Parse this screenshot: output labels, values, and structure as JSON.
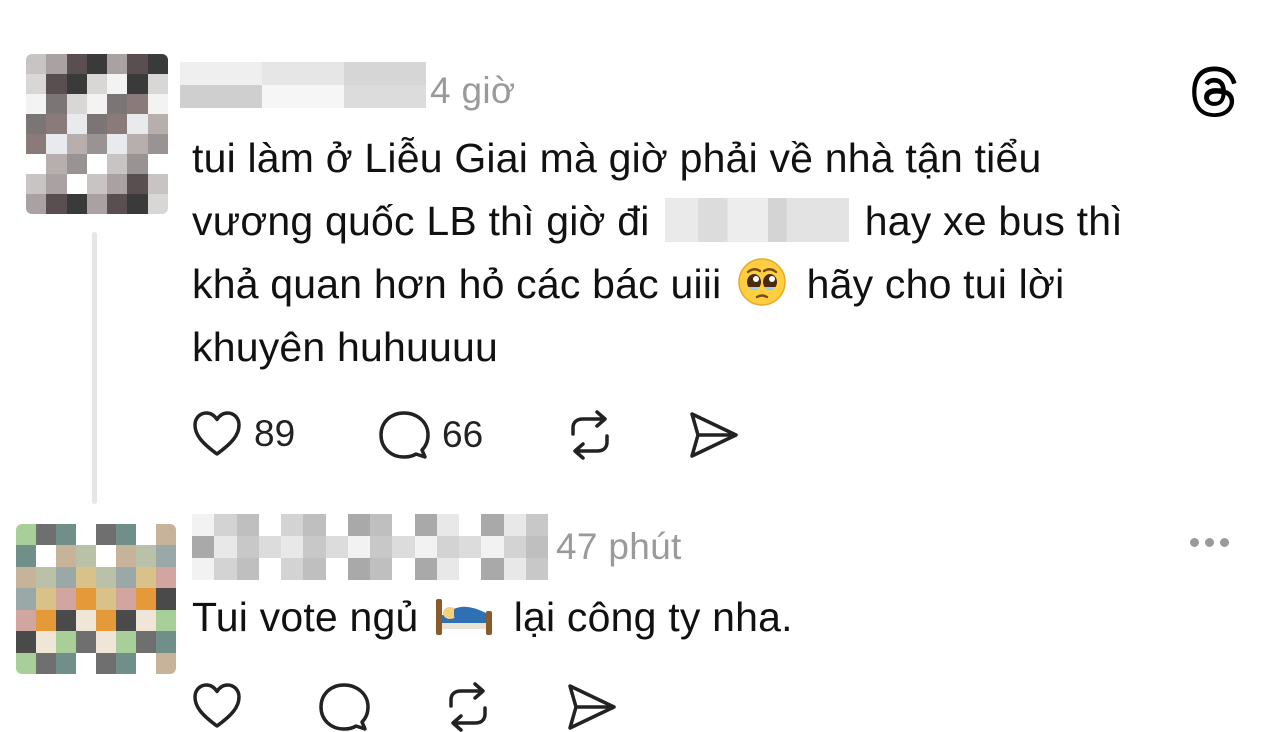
{
  "comments": [
    {
      "time": "4 giờ",
      "text_line1": "tui làm ở Liễu Giai mà giờ phải về nhà tận tiểu",
      "text_line2_a": "vương quốc LB thì giờ đi",
      "text_line2_b": "hay xe bus thì",
      "text_line3_a": "khả quan hơn hỏ các bác uiii",
      "text_line3_b": "hãy cho tui lời",
      "text_line4": "khuyên huhuuuu",
      "likes": "89",
      "replies": "66"
    },
    {
      "time": "47 phút",
      "text_a": "Tui vote ngủ",
      "text_b": "lại công ty nha."
    }
  ],
  "icons": {
    "like": "heart-icon",
    "reply": "speech-bubble-icon",
    "repost": "repost-icon",
    "share": "send-icon",
    "app_logo": "threads-logo-icon",
    "more": "more-options-icon"
  },
  "colors": {
    "text": "#101010",
    "muted": "#9a9a9a",
    "thread_line": "#e6e6e6"
  }
}
